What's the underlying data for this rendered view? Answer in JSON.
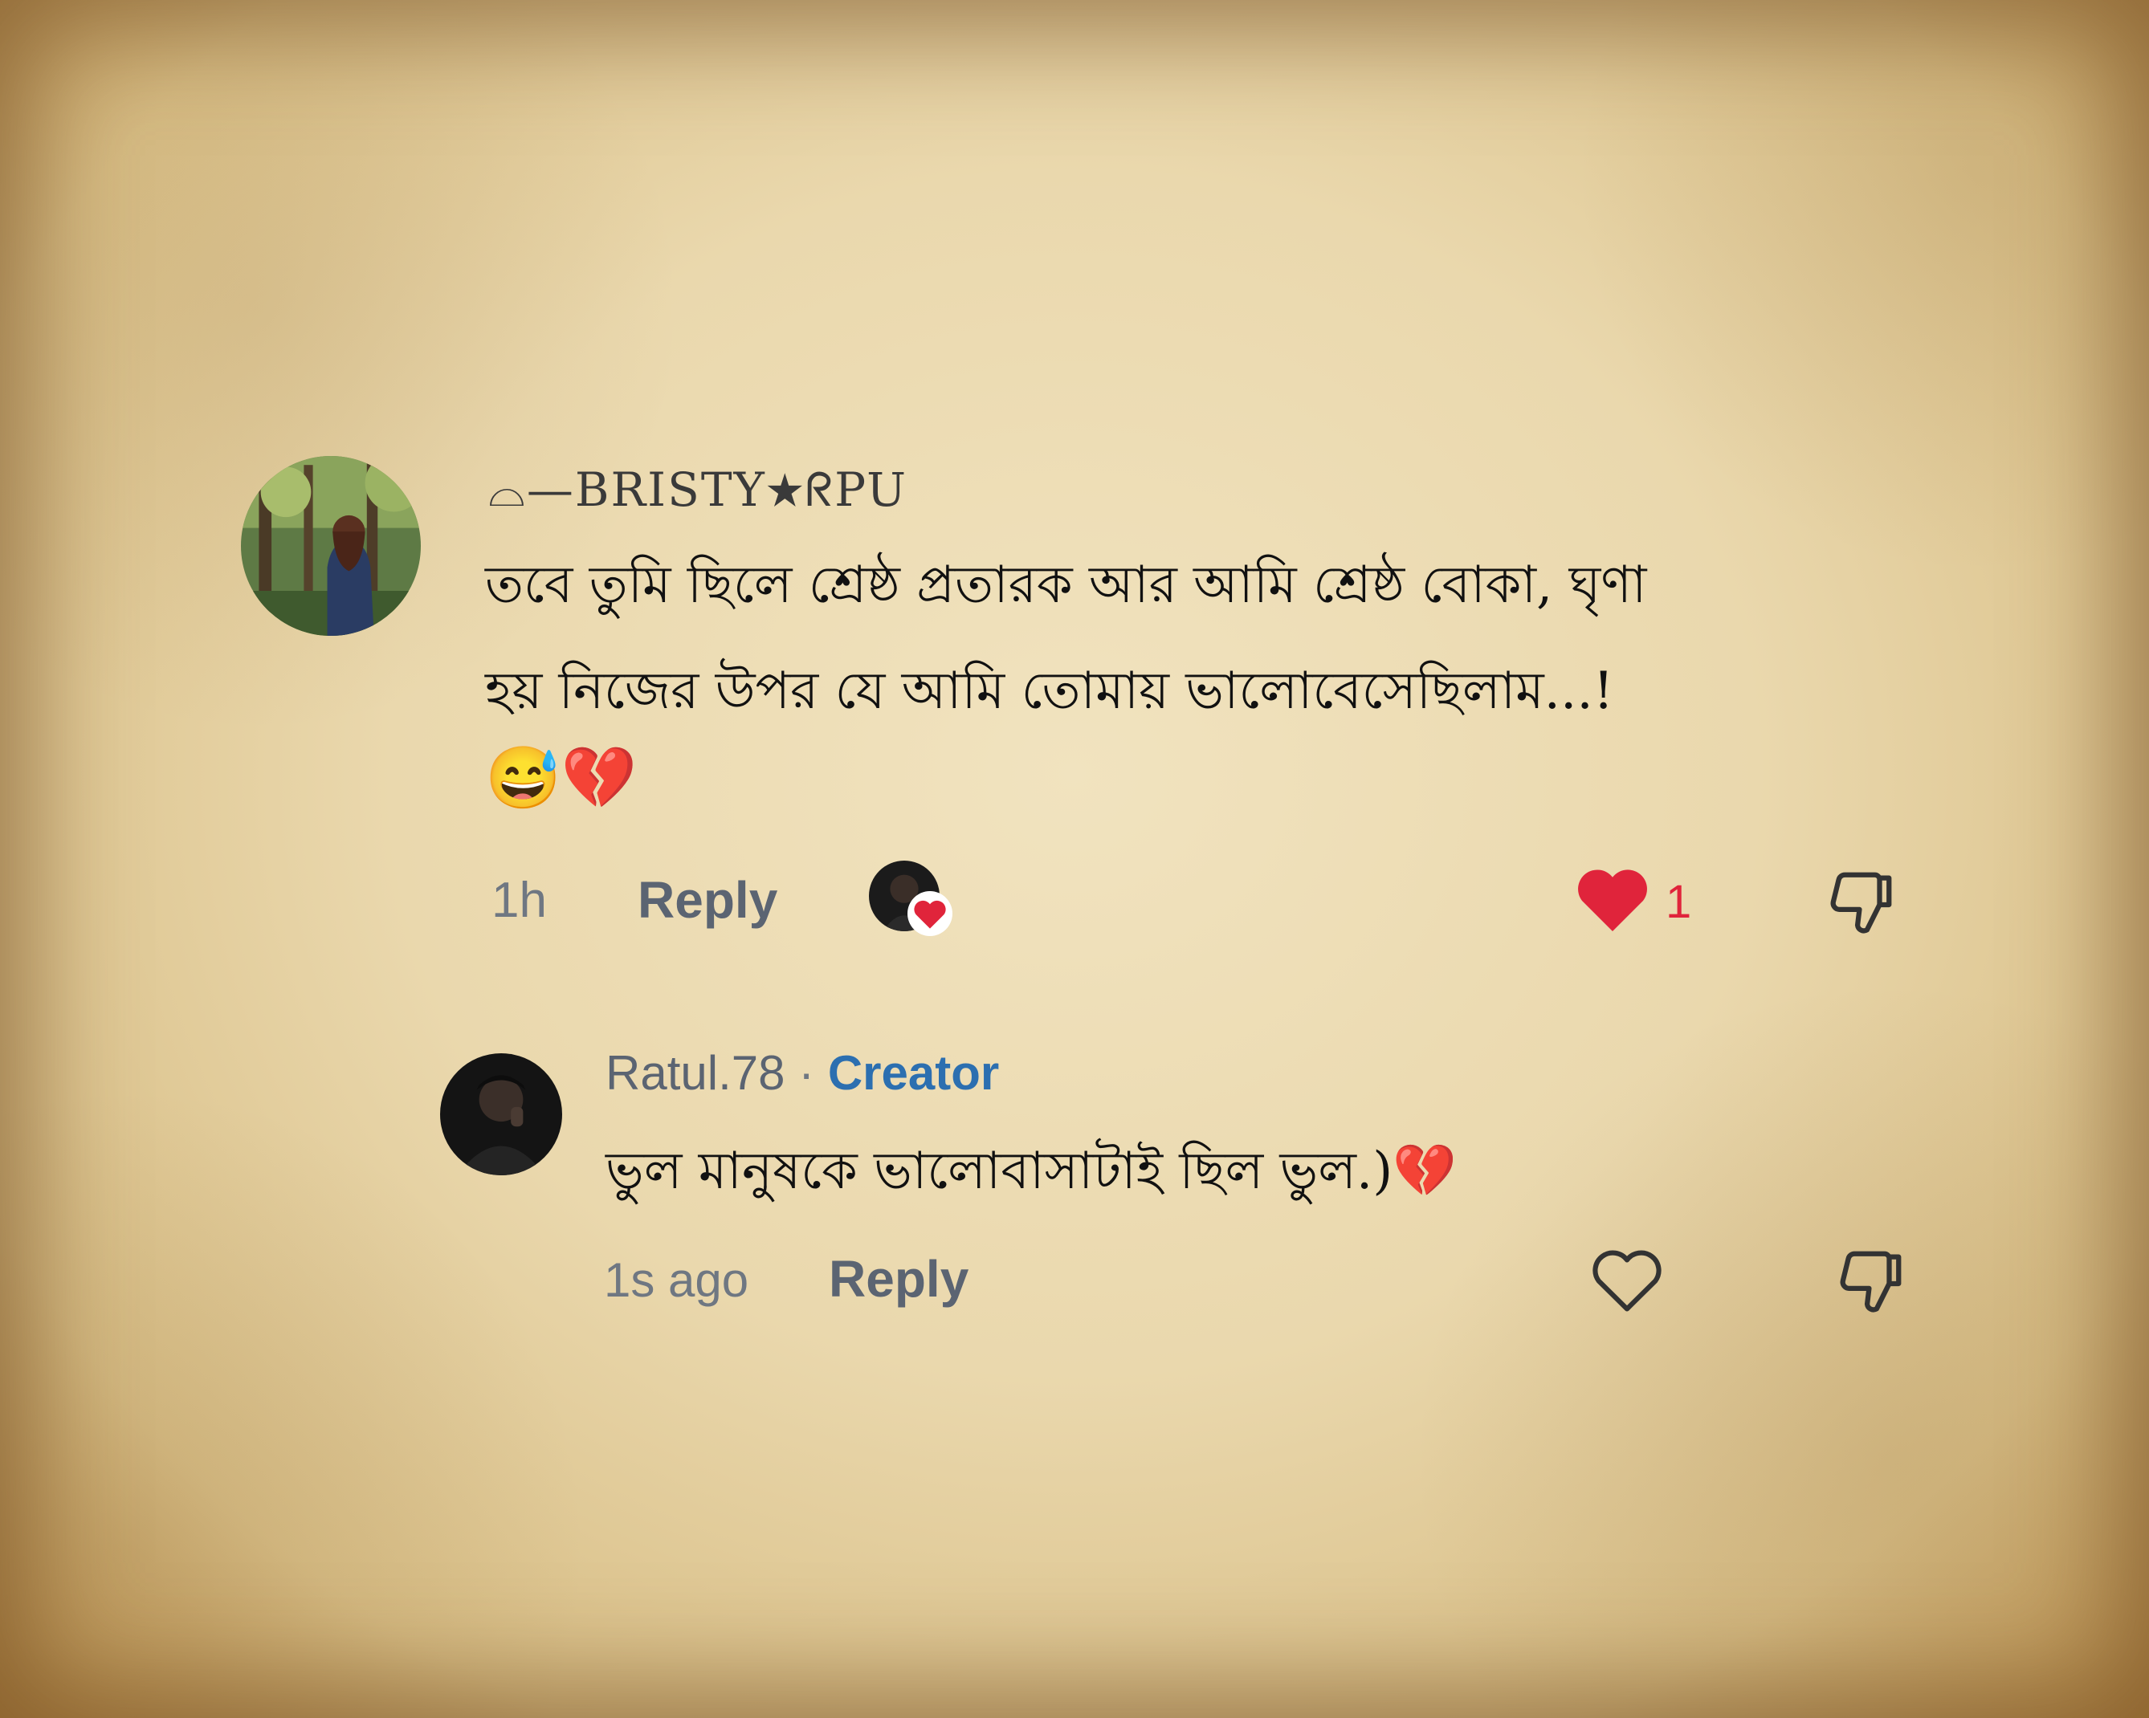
{
  "comment": {
    "username": "⌓—BRISTY★ᖇPU",
    "text_line1": "তবে তুমি ছিলে শ্রেষ্ঠ প্রতারক আর আমি শ্রেষ্ঠ বোকা, ঘৃণা",
    "text_line2": "হয় নিজের উপর যে আমি তোমায় ভালোবেসেছিলাম...!",
    "text_line3": "😅💔",
    "time": "1h",
    "reply_label": "Reply",
    "like_count": "1",
    "liked": true
  },
  "reply": {
    "username": "Ratul.78",
    "separator": "·",
    "badge": "Creator",
    "text": "ভুল মানুষকে ভালোবাসাটাই ছিল ভুল.)💔",
    "time": "1s ago",
    "reply_label": "Reply",
    "liked": false
  },
  "colors": {
    "like_red": "#e0243b",
    "creator_blue": "#2c6fb0",
    "meta_gray": "#6f7782"
  },
  "icons": [
    "heart-icon",
    "heart-outline-icon",
    "thumbs-down-icon"
  ]
}
